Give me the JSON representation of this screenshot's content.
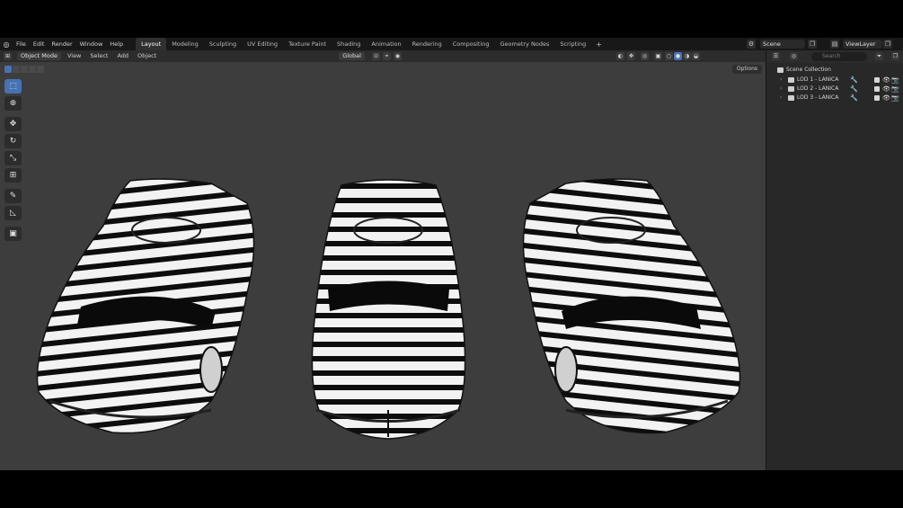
{
  "menu": [
    "File",
    "Edit",
    "Render",
    "Window",
    "Help"
  ],
  "workspaces": [
    {
      "label": "Layout",
      "active": true
    },
    {
      "label": "Modeling",
      "active": false
    },
    {
      "label": "Sculpting",
      "active": false
    },
    {
      "label": "UV Editing",
      "active": false
    },
    {
      "label": "Texture Paint",
      "active": false
    },
    {
      "label": "Shading",
      "active": false
    },
    {
      "label": "Animation",
      "active": false
    },
    {
      "label": "Rendering",
      "active": false
    },
    {
      "label": "Compositing",
      "active": false
    },
    {
      "label": "Geometry Nodes",
      "active": false
    },
    {
      "label": "Scripting",
      "active": false
    }
  ],
  "add_workspace": "+",
  "scene": "Scene",
  "view_layer": "ViewLayer",
  "viewport_header": {
    "mode": "Object Mode",
    "menus": [
      "View",
      "Select",
      "Add",
      "Object"
    ],
    "orientation": "Global"
  },
  "options_label": "Options",
  "outliner": {
    "search_placeholder": "Search",
    "root": "Scene Collection",
    "items": [
      {
        "label": "LOD 1 - LANICA"
      },
      {
        "label": "LOD 2 - LANICA"
      },
      {
        "label": "LOD 3 - LANICA"
      }
    ]
  },
  "icons": {
    "app": "blender-logo-icon",
    "tools": [
      "select-box-icon",
      "cursor-icon",
      "move-icon",
      "rotate-icon",
      "scale-icon",
      "transform-icon",
      "annotate-icon",
      "measure-icon",
      "add-cube-icon"
    ]
  },
  "colors": {
    "accent": "#4772b3",
    "viewport_bg": "#3d3d3d",
    "modifier_icon": "#e6884b"
  }
}
